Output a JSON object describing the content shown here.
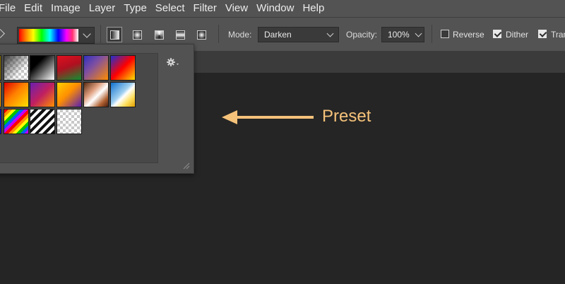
{
  "menubar": {
    "items": [
      "File",
      "Edit",
      "Image",
      "Layer",
      "Type",
      "Select",
      "Filter",
      "View",
      "Window",
      "Help"
    ]
  },
  "options_bar": {
    "gradient_types": [
      "linear",
      "radial",
      "angle",
      "reflected",
      "diamond"
    ],
    "active_gradient_type": "linear",
    "mode_label": "Mode:",
    "mode_value": "Darken",
    "opacity_label": "Opacity:",
    "opacity_value": "100%",
    "reverse_label": "Reverse",
    "reverse_checked": false,
    "dither_label": "Dither",
    "dither_checked": true,
    "transparency_label": "Tran",
    "transparency_checked": true
  },
  "gradient_picker": {
    "settings_icon": "gear-icon",
    "presets": [
      [
        "yellow-checker",
        "checker-gradient",
        "black-white",
        "red-green",
        "orange-blue",
        "blue-red-yellow"
      ],
      [
        "blue-red-yellow",
        "red-yellow",
        "purple-orange",
        "yellow-violet",
        "copper",
        "blue-white-yellow"
      ],
      [
        "spectrum",
        "rainbow-stripes",
        "black-stripes",
        "transparent"
      ]
    ]
  },
  "annotation": {
    "label": "Preset",
    "color": "#f5c27a"
  },
  "colors": {
    "menubar_bg": "#535353",
    "canvas_bg": "#252525",
    "panel_bg": "#525252"
  }
}
